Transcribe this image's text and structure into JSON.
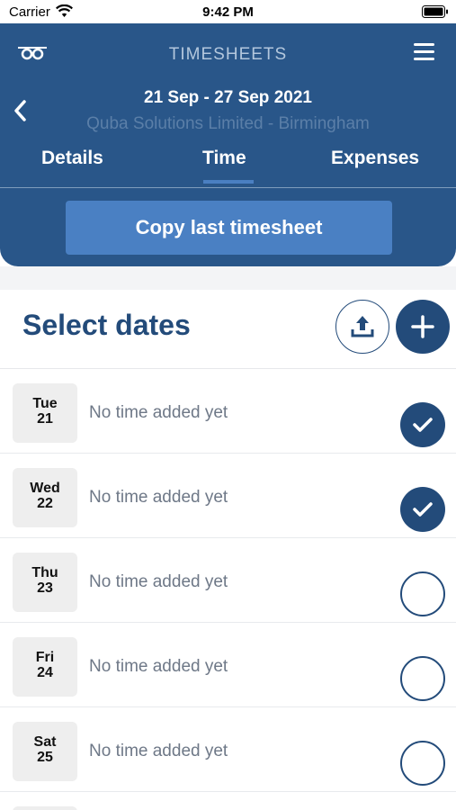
{
  "status_bar": {
    "carrier": "Carrier",
    "time": "9:42 PM"
  },
  "header": {
    "title": "TIMESHEETS",
    "date_range": "21 Sep - 27 Sep 2021",
    "company": "Quba Solutions Limited - Birmingham",
    "tabs": [
      "Details",
      "Time",
      "Expenses"
    ],
    "active_tab": "Time",
    "copy_button_label": "Copy last timesheet"
  },
  "section": {
    "title": "Select dates"
  },
  "days": [
    {
      "name": "Tue",
      "num": "21",
      "status": "No time added yet",
      "selected": true
    },
    {
      "name": "Wed",
      "num": "22",
      "status": "No time added yet",
      "selected": true
    },
    {
      "name": "Thu",
      "num": "23",
      "status": "No time added yet",
      "selected": false
    },
    {
      "name": "Fri",
      "num": "24",
      "status": "No time added yet",
      "selected": false
    },
    {
      "name": "Sat",
      "num": "25",
      "status": "No time added yet",
      "selected": false
    }
  ],
  "colors": {
    "primary": "#295689",
    "accent": "#4a80c3",
    "dark": "#234b7a"
  }
}
